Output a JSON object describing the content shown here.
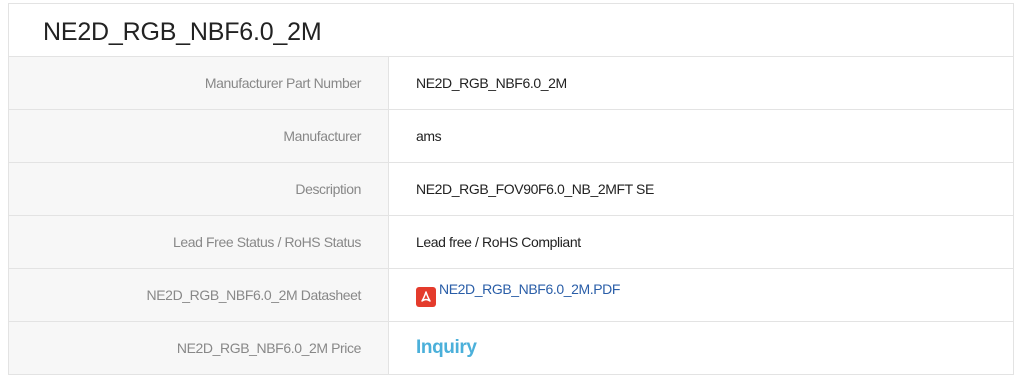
{
  "title": "NE2D_RGB_NBF6.0_2M",
  "rows": [
    {
      "label": "Manufacturer Part Number",
      "value": "NE2D_RGB_NBF6.0_2M"
    },
    {
      "label": "Manufacturer",
      "value": "ams"
    },
    {
      "label": "Description",
      "value": "NE2D_RGB_FOV90F6.0_NB_2MFT SE"
    },
    {
      "label": "Lead Free Status / RoHS Status",
      "value": "Lead free / RoHS Compliant"
    },
    {
      "label": "NE2D_RGB_NBF6.0_2M Datasheet",
      "value": "NE2D_RGB_NBF6.0_2M.PDF",
      "icon": "pdf-icon"
    },
    {
      "label": "NE2D_RGB_NBF6.0_2M Price",
      "value": "Inquiry"
    }
  ],
  "colors": {
    "link": "#2a5ea8",
    "inquiry": "#4bb0da",
    "pdf_icon": "#e43b2c"
  }
}
